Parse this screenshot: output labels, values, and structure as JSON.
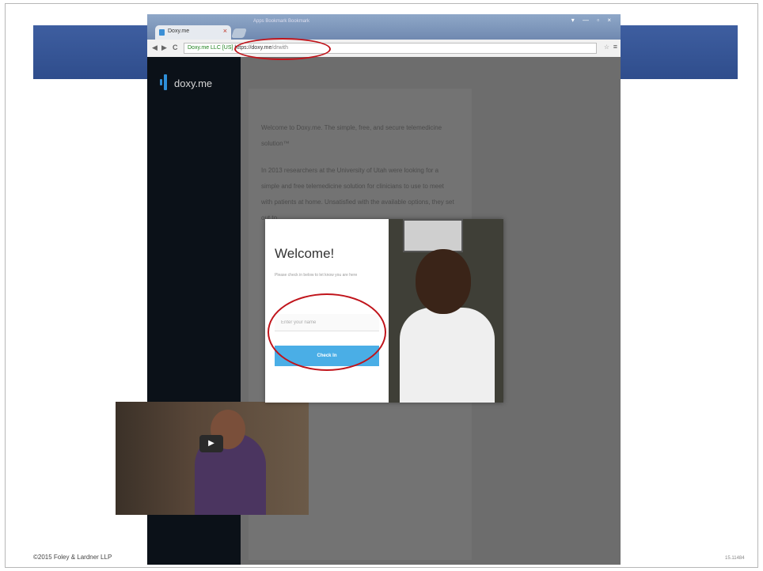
{
  "slide": {
    "copyright": "©2015 Foley & Lardner LLP",
    "slide_number": "15.11484",
    "accent_band_color": "#34548f"
  },
  "browser": {
    "tab_title": "Doxy.me",
    "tab_close_glyph": "×",
    "bookmarks_text": "Apps   Bookmark   Bookmark",
    "window_controls": "▾ — ▫ ×",
    "back_glyph": "◀",
    "forward_glyph": "▶",
    "reload_glyph": "C",
    "url_secure_label": "Doxy.me LLC [US]",
    "url_host": "https://doxy.me",
    "url_path": "/drwith",
    "star_glyph": "☆",
    "menu_glyph": "≡"
  },
  "sidebar": {
    "logo_text": "doxy.me",
    "logo_color": "#2e8fd8"
  },
  "main": {
    "paragraph_1": "Welcome to Doxy.me. The simple, free, and secure telemedicine solution™",
    "paragraph_2": "In 2013 researchers at the University of Utah were looking for a simple and free telemedicine solution for clinicians to use to meet with patients at home. Unsatisfied with the available options, they set out to"
  },
  "modal": {
    "title": "Welcome!",
    "subtitle": "Please check in below to let know you are here",
    "name_placeholder": "Enter your name",
    "checkin_label": "Check In",
    "button_color": "#4aaee6"
  },
  "video": {
    "play_glyph": "▶"
  }
}
